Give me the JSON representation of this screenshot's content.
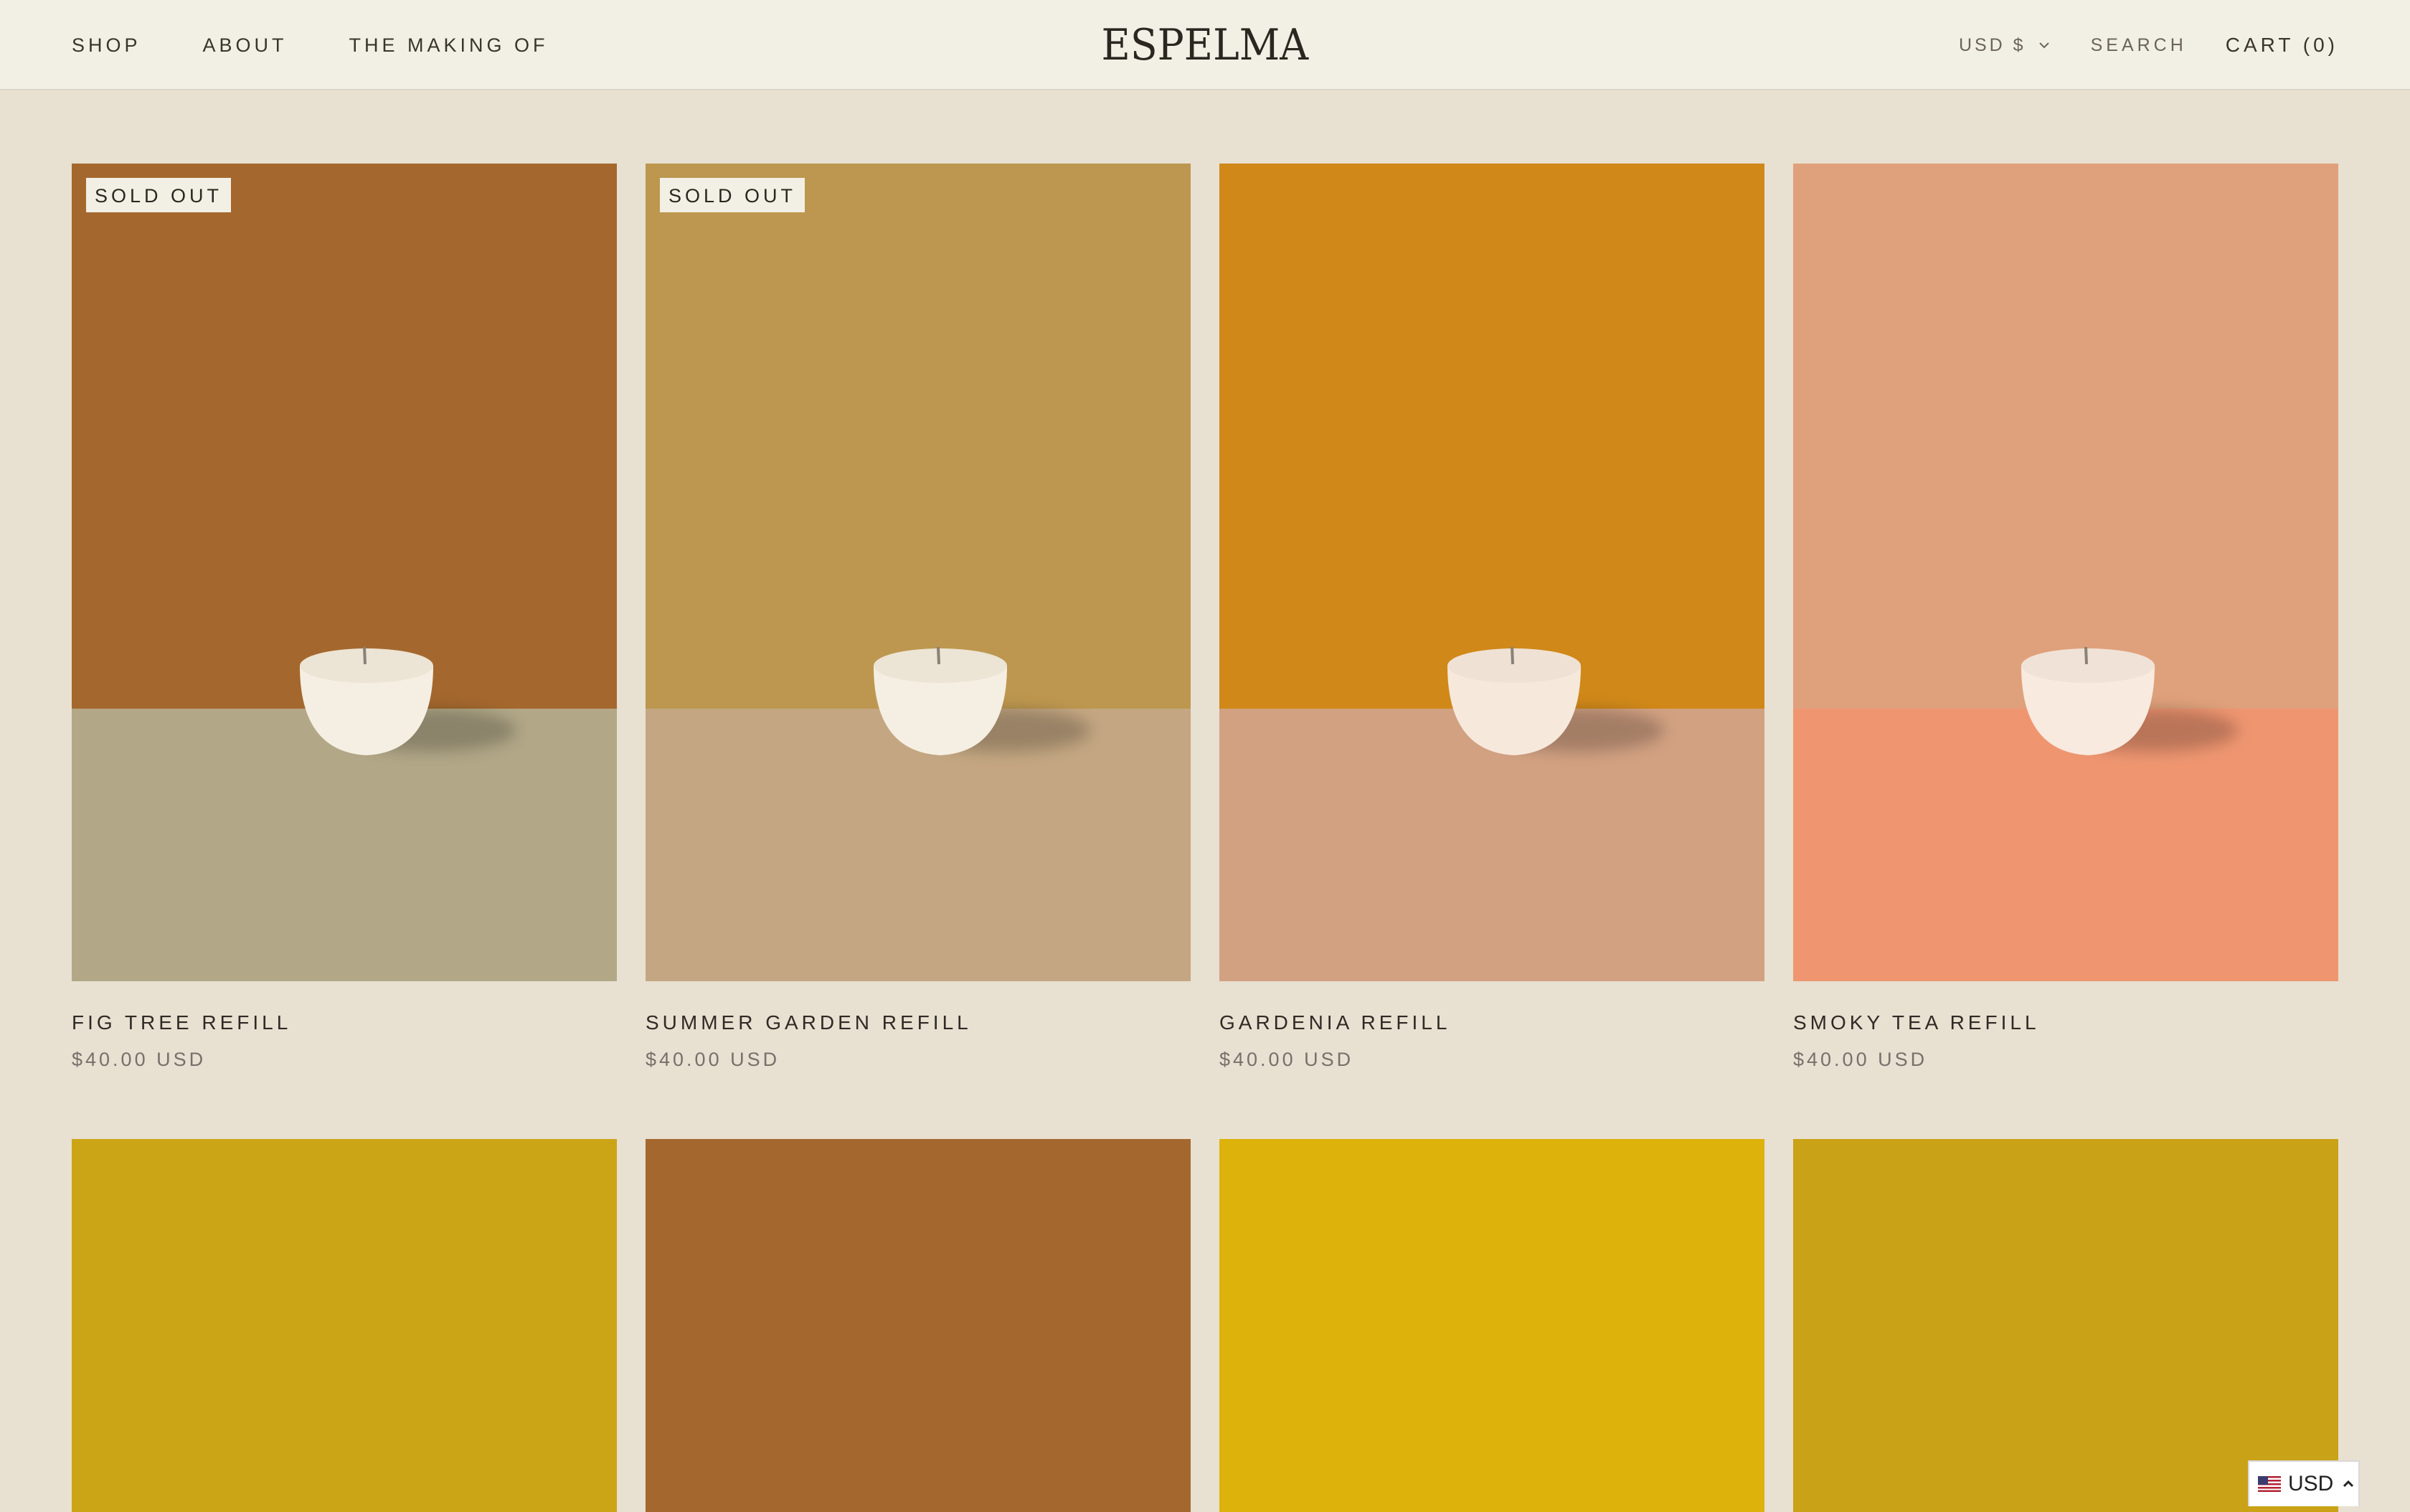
{
  "header": {
    "nav": [
      "SHOP",
      "ABOUT",
      "THE MAKING OF"
    ],
    "logo": "ESPELMA",
    "currency": "USD $",
    "search": "SEARCH",
    "cart": "CART (0)"
  },
  "products": [
    {
      "title": "FIG TREE REFILL",
      "price": "$40.00 USD",
      "badge": "SOLD OUT",
      "wall": "#a4682e",
      "floor": "#b2a888"
    },
    {
      "title": "SUMMER GARDEN REFILL",
      "price": "$40.00 USD",
      "badge": "SOLD OUT",
      "wall": "#bd974f",
      "floor": "#c4a782"
    },
    {
      "title": "GARDENIA REFILL",
      "price": "$40.00 USD",
      "badge": "",
      "wall": "#d08819",
      "floor": "#d2a182"
    },
    {
      "title": "SMOKY TEA REFILL",
      "price": "$40.00 USD",
      "badge": "",
      "wall": "#dfa17b",
      "floor": "#ef9671"
    }
  ],
  "second_row_colors": [
    "#cca517",
    "#a4682e",
    "#dcb20b",
    "#c9a217"
  ],
  "currency_widget": {
    "label": "USD"
  }
}
